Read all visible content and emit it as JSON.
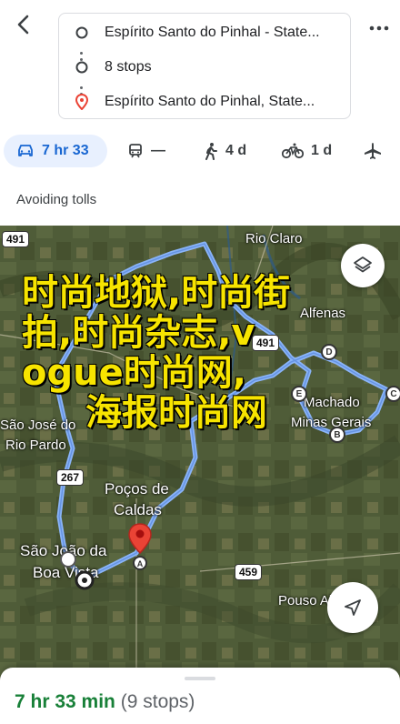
{
  "header": {
    "stops": [
      {
        "label": "Espírito Santo do Pinhal - State..."
      },
      {
        "label": "8 stops"
      },
      {
        "label": "Espírito Santo do Pinhal, State..."
      }
    ]
  },
  "modes": [
    {
      "name": "drive",
      "label": "7 hr 33",
      "active": true
    },
    {
      "name": "transit",
      "label": "—"
    },
    {
      "name": "walk",
      "label": "4 d"
    },
    {
      "name": "bike",
      "label": "1 d"
    },
    {
      "name": "flight",
      "label": ""
    }
  ],
  "avoid_label": "Avoiding tolls",
  "map": {
    "labels": {
      "rio_claro": "Rio Claro",
      "alfenas": "Alfenas",
      "machado": "Machado",
      "minas_gerais": "Minas Gerais",
      "sao_jose": "São José do",
      "rio_pardo": "Rio Pardo",
      "pocos": "Poços de",
      "caldas": "Caldas",
      "sao_joao": "São João da",
      "boa_vista": "Boa Vista",
      "pouso_alegre": "Pouso Alegre"
    },
    "shields": {
      "s491a": "491",
      "s491b": "491",
      "s267": "267",
      "s459": "459"
    },
    "waypoints": {
      "d": "D",
      "e": "E",
      "c": "C",
      "b": "B"
    },
    "route_color": "#8ab4f8",
    "watermark": [
      "时尚地狱,时尚街",
      "拍,时尚杂志,v",
      "ogue时尚网,",
      "  海报时尚网"
    ]
  },
  "summary": {
    "time": "7 hr 33 min",
    "stops": "(9 stops)"
  },
  "colors": {
    "accent": "#1967d2",
    "active_bg": "#e8f0fe",
    "time_green": "#188038",
    "pin_red": "#ea4335"
  }
}
